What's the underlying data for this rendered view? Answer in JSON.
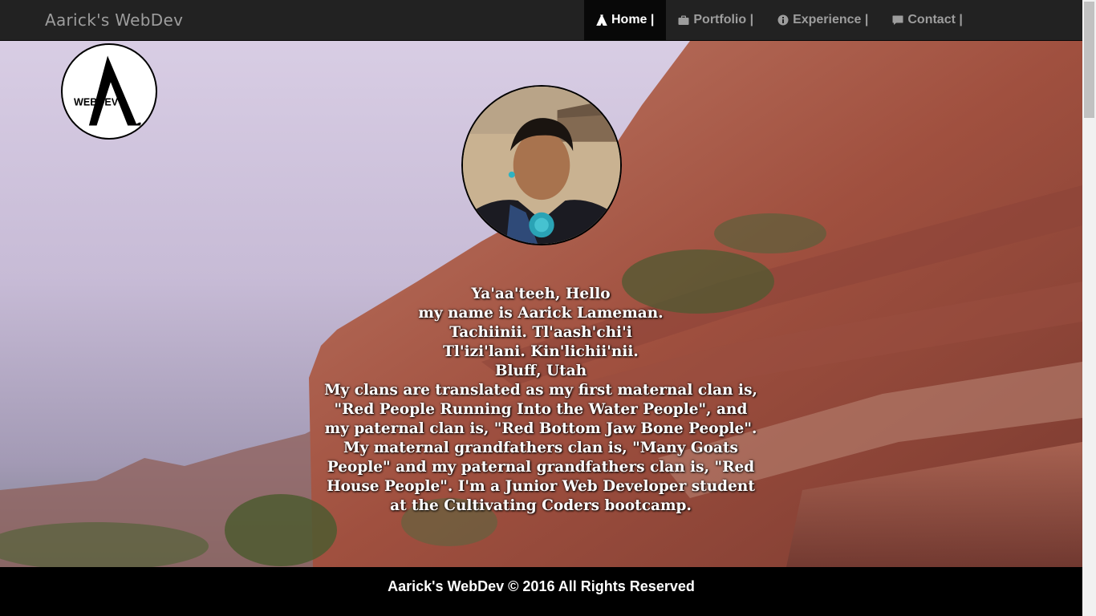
{
  "navbar": {
    "brand": "Aarick's WebDev",
    "items": [
      {
        "label": "Home |",
        "icon": "tipi-icon",
        "active": true
      },
      {
        "label": "Portfolio |",
        "icon": "briefcase-icon",
        "active": false
      },
      {
        "label": "Experience |",
        "icon": "info-circle-icon",
        "active": false
      },
      {
        "label": "Contact |",
        "icon": "comment-icon",
        "active": false
      }
    ]
  },
  "hero": {
    "logo": {
      "letter": "A",
      "text": "WEBDEV"
    },
    "intro_lines": [
      "Ya'aa'teeh, Hello",
      "my name is Aarick Lameman.",
      "Tachiinii. Tl'aash'chi'i",
      "Tl'izi'lani. Kin'lichii'nii.",
      "Bluff, Utah",
      "My clans are translated as my first maternal clan is,",
      "\"Red People Running Into the Water People\", and",
      "my paternal clan is, \"Red Bottom Jaw Bone People\".",
      "My maternal grandfathers clan is, \"Many Goats",
      "People\" and my paternal grandfathers clan is, \"Red",
      "House People\". I'm a Junior Web Developer student",
      "at the Cultivating Coders bootcamp."
    ]
  },
  "footer": {
    "text": "Aarick's WebDev © 2016 All Rights Reserved"
  },
  "colors": {
    "navbar_bg": "#222222",
    "nav_text": "#9d9d9d",
    "nav_active_bg": "#080808",
    "rock": "#a8584a",
    "sky": "#d8cde4",
    "footer_bg": "#000000"
  }
}
